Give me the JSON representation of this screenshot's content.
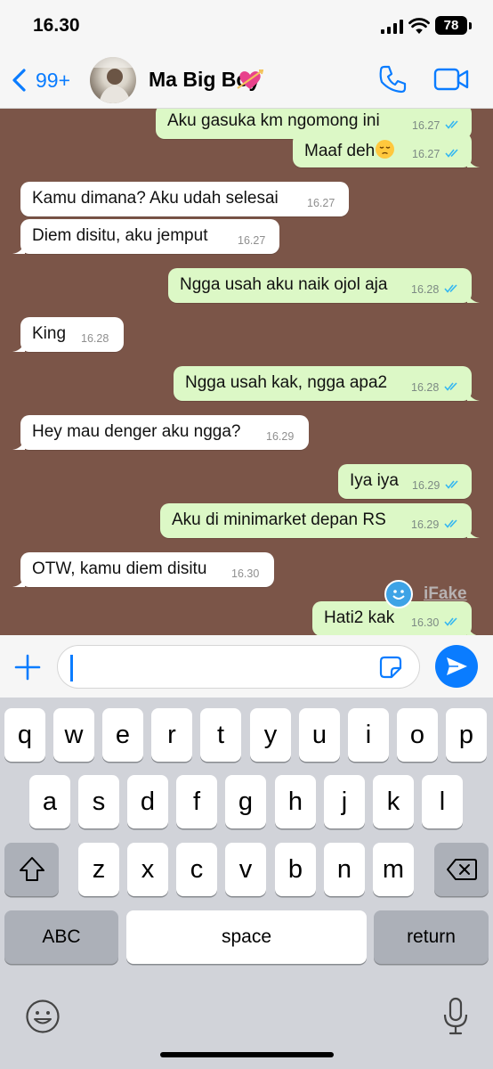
{
  "status": {
    "time": "16.30",
    "battery": "78"
  },
  "header": {
    "back_count": "99+",
    "contact_name": "Ma Big Boy",
    "heart_icon": "heart-with-arrow-icon"
  },
  "messages": [
    {
      "dir": "out",
      "text": "Aku gasuka km ngomong ini",
      "time": "16.27",
      "read": true
    },
    {
      "dir": "out",
      "text": "Maaf deh",
      "emoji": "pensive-face",
      "time": "16.27",
      "read": true
    },
    {
      "dir": "in",
      "text": "Kamu dimana? Aku udah selesai",
      "time": "16.27"
    },
    {
      "dir": "in",
      "text": "Diem disitu, aku jemput",
      "time": "16.27"
    },
    {
      "dir": "out",
      "text": "Ngga usah aku naik ojol aja",
      "time": "16.28",
      "read": true
    },
    {
      "dir": "in",
      "text": "King",
      "time": "16.28"
    },
    {
      "dir": "out",
      "text": "Ngga usah kak, ngga apa2",
      "time": "16.28",
      "read": true
    },
    {
      "dir": "in",
      "text": "Hey mau denger aku ngga?",
      "time": "16.29"
    },
    {
      "dir": "out",
      "text": "Iya iya",
      "time": "16.29",
      "read": true
    },
    {
      "dir": "out",
      "text": "Aku di minimarket depan RS",
      "time": "16.29",
      "read": true
    },
    {
      "dir": "in",
      "text": "OTW, kamu diem disitu",
      "time": "16.30"
    },
    {
      "dir": "out",
      "text": "Hati2 kak",
      "time": "16.30",
      "read": true
    }
  ],
  "watermark": "iFake",
  "composer": {
    "value": "",
    "placeholder": ""
  },
  "keyboard": {
    "row1": [
      "q",
      "w",
      "e",
      "r",
      "t",
      "y",
      "u",
      "i",
      "o",
      "p"
    ],
    "row2": [
      "a",
      "s",
      "d",
      "f",
      "g",
      "h",
      "j",
      "k",
      "l"
    ],
    "row3": [
      "z",
      "x",
      "c",
      "v",
      "b",
      "n",
      "m"
    ],
    "abc": "ABC",
    "space": "space",
    "return": "return"
  },
  "colors": {
    "chat_background": "#7b5548",
    "outgoing_bubble": "#dcf8c6",
    "incoming_bubble": "#ffffff",
    "accent": "#0a7cff",
    "read_ticks": "#34b7f1"
  }
}
